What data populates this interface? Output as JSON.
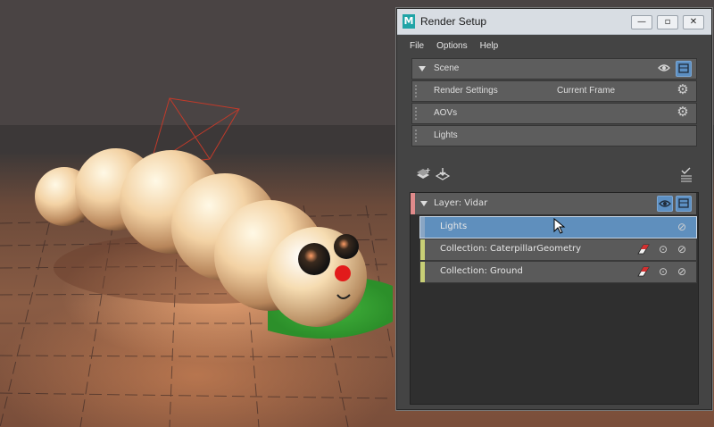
{
  "window": {
    "title": "Render Setup",
    "logo_letter": "M",
    "controls": {
      "minimize": "—",
      "maximize": "▫",
      "close": "✕"
    }
  },
  "menu": [
    "File",
    "Options",
    "Help"
  ],
  "top_rows": {
    "scene": {
      "label": "Scene"
    },
    "render_settings": {
      "label": "Render Settings",
      "value": "Current Frame"
    },
    "aovs": {
      "label": "AOVs"
    },
    "lights": {
      "label": "Lights"
    }
  },
  "layer": {
    "label": "Layer:  Vidar",
    "stripe_color": "#e08b8b",
    "children": [
      {
        "label": "Lights",
        "selected": true,
        "stripe_color": "#5f8fbd"
      },
      {
        "label": "Collection:  CaterpillarGeometry",
        "selected": false,
        "stripe_color": "#c8cf76"
      },
      {
        "label": "Collection:  Ground",
        "selected": false,
        "stripe_color": "#c8cf76"
      }
    ]
  },
  "icons": {
    "eye": "eye-icon",
    "render": "render-icon",
    "gear": "gear-icon",
    "create_layer": "create-layer-icon",
    "import_layer": "import-layer-icon",
    "batch_render": "batch-render-icon",
    "isolate": "isolate-icon",
    "disable": "disable-icon",
    "eraser": "eraser-icon"
  },
  "colors": {
    "titlebar": "#d8dde3",
    "selection": "#5f8fbd",
    "accent_button": "#5c8fc2"
  }
}
